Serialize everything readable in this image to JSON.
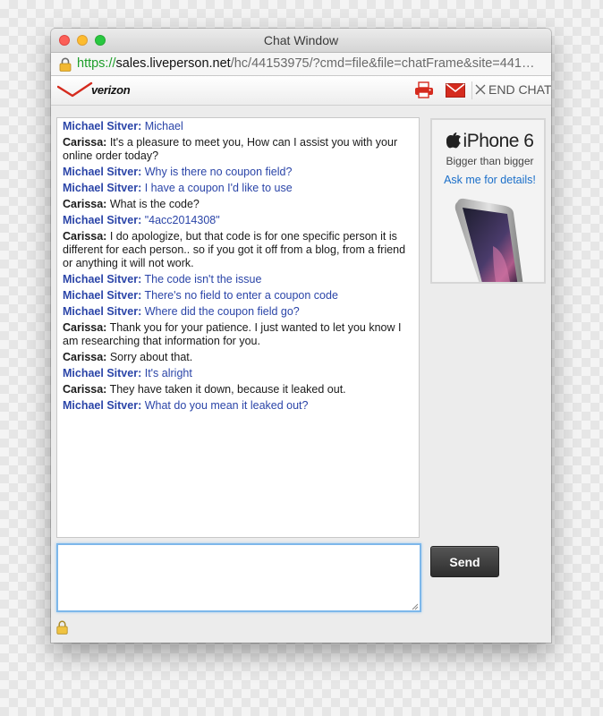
{
  "window": {
    "title": "Chat Window"
  },
  "browser": {
    "url_scheme": "https://",
    "url_host": "sales.liveperson.net",
    "url_path": "/hc/44153975/?cmd=file&file=chatFrame&site=441…"
  },
  "toolbar": {
    "logo_text": "verizon",
    "end_chat_label": "END CHAT",
    "icons": [
      "print-icon",
      "email-icon",
      "close-icon"
    ]
  },
  "transcript": {
    "messages": [
      {
        "speaker": "Michael Sitver:",
        "text": "Michael",
        "role": "visitor"
      },
      {
        "speaker": "Carissa:",
        "text": "It's a pleasure to meet you, How can I assist you with your online order today?",
        "role": "agent"
      },
      {
        "speaker": "Michael Sitver:",
        "text": "Why is there no coupon field?",
        "role": "visitor"
      },
      {
        "speaker": "Michael Sitver:",
        "text": "I have a coupon I'd like to use",
        "role": "visitor"
      },
      {
        "speaker": "Carissa:",
        "text": "What is the code?",
        "role": "agent"
      },
      {
        "speaker": "Michael Sitver:",
        "text": "\"4acc2014308\"",
        "role": "visitor"
      },
      {
        "speaker": "Carissa:",
        "text": "I do apologize, but that code is for one specific person it is different for each person.. so if you got it off from a blog, from a friend or anything it will not work.",
        "role": "agent"
      },
      {
        "speaker": "Michael Sitver:",
        "text": "The code isn't the issue",
        "role": "visitor"
      },
      {
        "speaker": "Michael Sitver:",
        "text": "There's no field to enter a coupon code",
        "role": "visitor"
      },
      {
        "speaker": "Michael Sitver:",
        "text": "Where did the coupon field go?",
        "role": "visitor"
      },
      {
        "speaker": "Carissa:",
        "text": "Thank you for your patience. I just wanted to let you know I am researching that information for you.",
        "role": "agent"
      },
      {
        "speaker": "Carissa:",
        "text": "Sorry about that.",
        "role": "agent"
      },
      {
        "speaker": "Michael Sitver:",
        "text": "It's alright",
        "role": "visitor"
      },
      {
        "speaker": "Carissa:",
        "text": "They have taken it down, because it leaked out.",
        "role": "agent"
      },
      {
        "speaker": "Michael Sitver:",
        "text": "What do you mean it leaked out?",
        "role": "visitor"
      }
    ]
  },
  "ad": {
    "brand": "iPhone 6",
    "tagline": "Bigger than bigger",
    "cta": "Ask me for details!"
  },
  "composer": {
    "value": "",
    "send_label": "Send"
  },
  "colors": {
    "visitor_text": "#2b45a8",
    "agent_text": "#1a1a1a",
    "verizon_red": "#d52b1e",
    "link_blue": "#1b6fc9",
    "focus_blue": "#7db7ea",
    "url_green": "#1e9e2a"
  }
}
